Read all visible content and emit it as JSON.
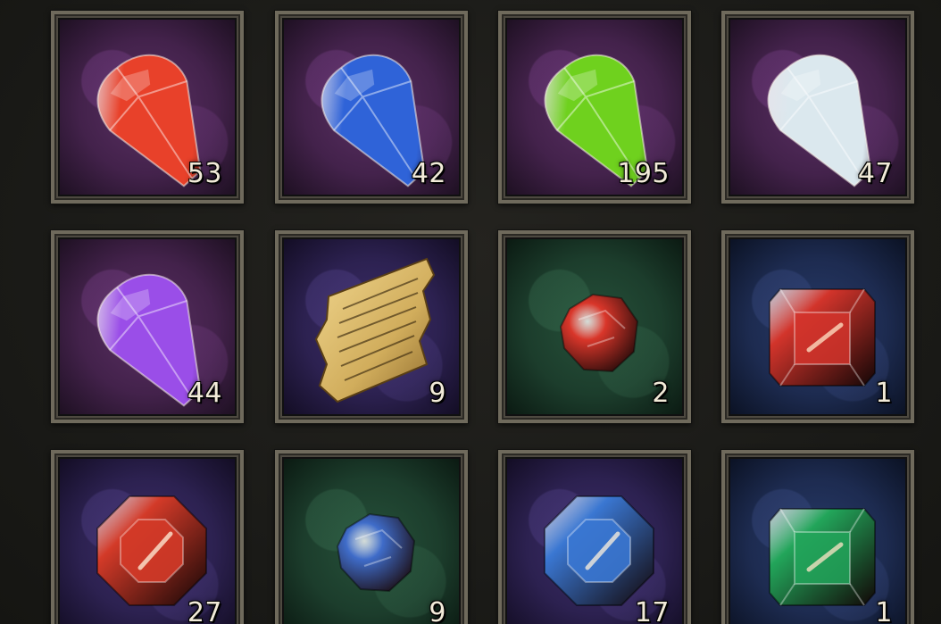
{
  "inventory": {
    "slots": [
      {
        "item": "red-crystal-shard-icon",
        "background": "purple",
        "gem_color": "#e8412a",
        "count": "53"
      },
      {
        "item": "blue-crystal-shard-icon",
        "background": "purple",
        "gem_color": "#2f63d8",
        "count": "42"
      },
      {
        "item": "green-crystal-shard-icon",
        "background": "purple",
        "gem_color": "#6fd11e",
        "count": "195"
      },
      {
        "item": "white-crystal-shard-icon",
        "background": "purple",
        "gem_color": "#dbe8ee",
        "count": "47"
      },
      {
        "item": "purple-crystal-shard-icon",
        "background": "purple",
        "gem_color": "#9a4ee8",
        "count": "44"
      },
      {
        "item": "parchment-scroll-icon",
        "background": "indigo",
        "gem_color": "#d8b76a",
        "count": "9"
      },
      {
        "item": "red-rough-gem-icon",
        "background": "green",
        "gem_color": "#d9362a",
        "count": "2"
      },
      {
        "item": "red-square-cut-gem-icon",
        "background": "blue",
        "gem_color": "#d2342b",
        "count": "1"
      },
      {
        "item": "red-octagon-gem-icon",
        "background": "indigo",
        "gem_color": "#d33a28",
        "count": "27"
      },
      {
        "item": "blue-rough-gem-icon",
        "background": "green",
        "gem_color": "#3f6cc9",
        "count": "9"
      },
      {
        "item": "blue-octagon-gem-icon",
        "background": "indigo",
        "gem_color": "#3a77d2",
        "count": "17"
      },
      {
        "item": "green-square-cut-gem-icon",
        "background": "blue",
        "gem_color": "#22a55a",
        "count": "1"
      }
    ]
  }
}
